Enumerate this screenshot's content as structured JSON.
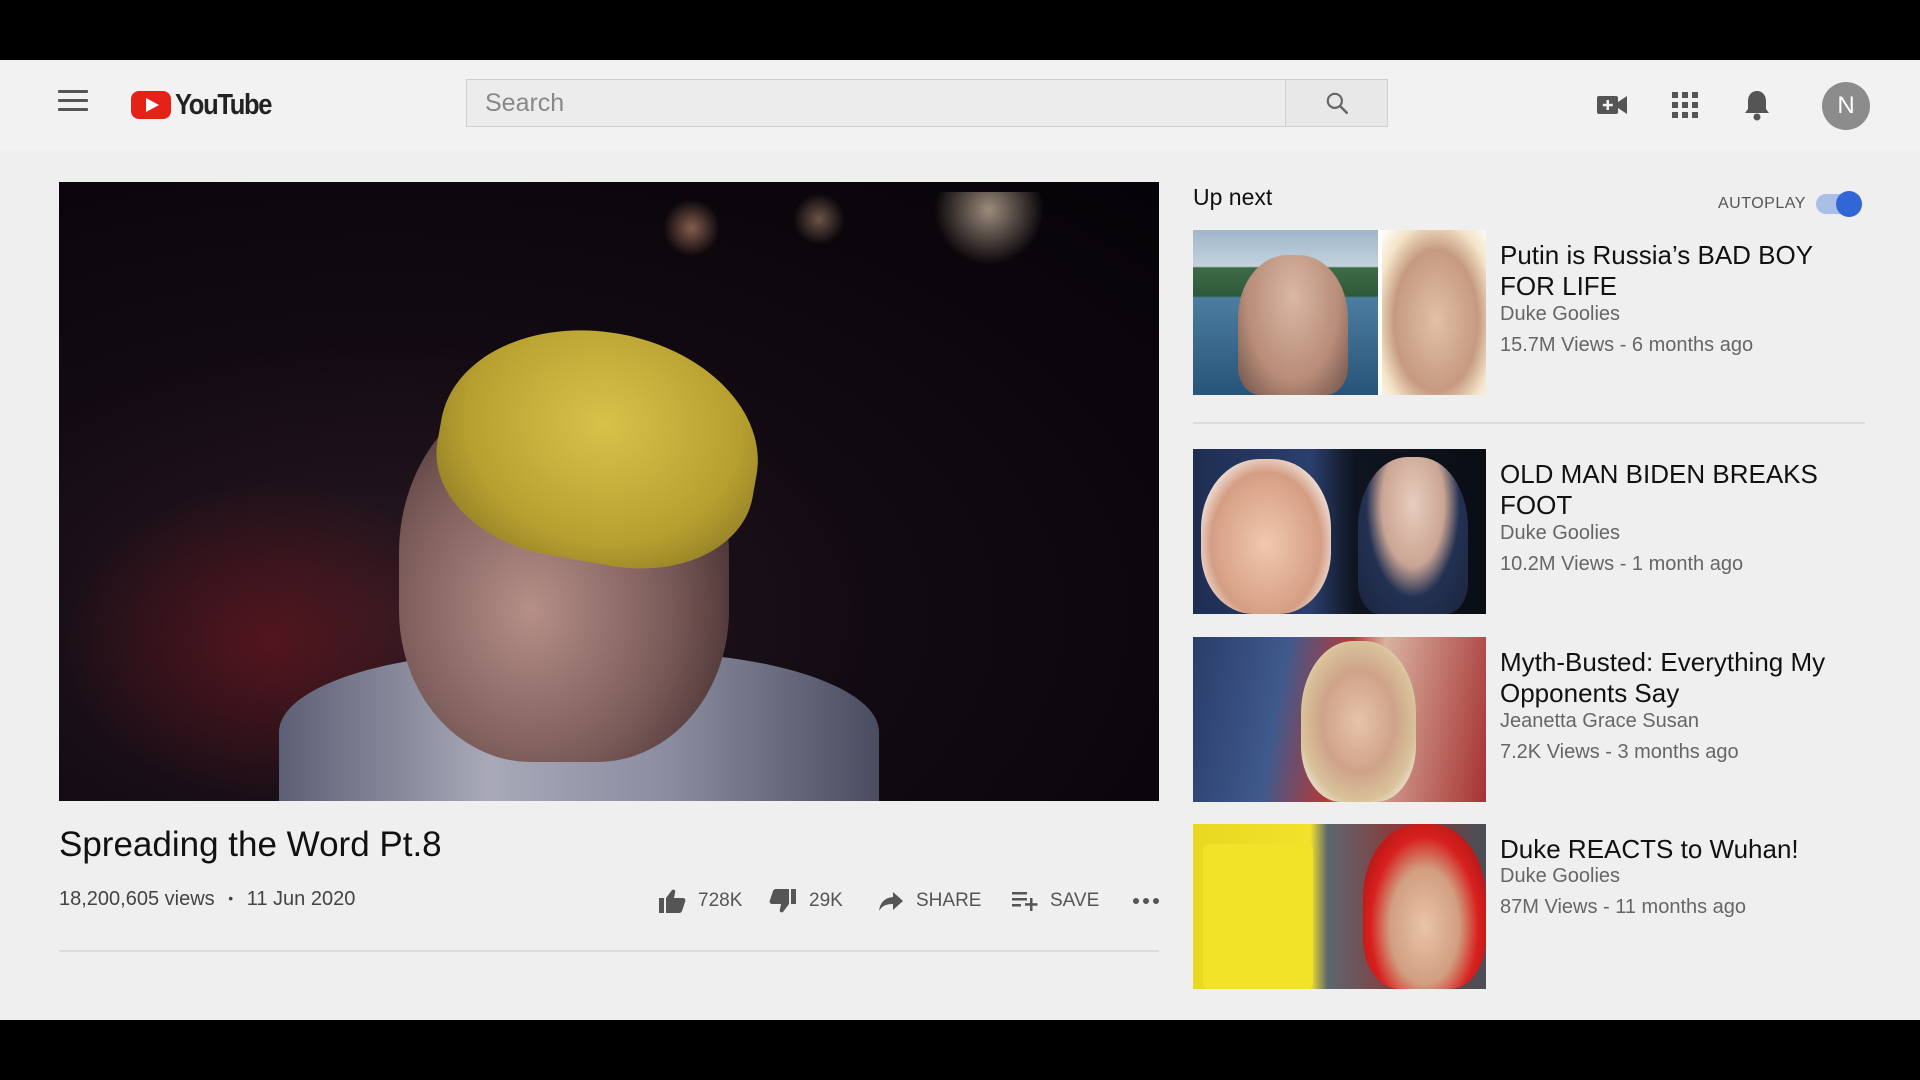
{
  "header": {
    "logo_text": "YouTube",
    "search_placeholder": "Search",
    "avatar_letter": "N"
  },
  "video": {
    "title": "Spreading the Word Pt.8",
    "views": "18,200,605 views",
    "date": "11 Jun 2020",
    "separator": "•",
    "likes": "728K",
    "dislikes": "29K",
    "share_label": "SHARE",
    "save_label": "SAVE"
  },
  "sidebar": {
    "up_next_label": "Up next",
    "autoplay_label": "AUTOPLAY",
    "autoplay_on": true,
    "items": [
      {
        "title": "Putin is Russia’s BAD BOY FOR LIFE",
        "channel": "Duke Goolies",
        "stats": "15.7M Views - 6 months ago"
      },
      {
        "title": "OLD MAN BIDEN BREAKS FOOT",
        "channel": "Duke Goolies",
        "stats": "10.2M Views - 1 month ago"
      },
      {
        "title": "Myth-Busted: Everything My Opponents Say",
        "channel": "Jeanetta Grace Susan",
        "stats": "7.2K Views - 3 months ago"
      },
      {
        "title": "Duke REACTS to Wuhan!",
        "channel": "Duke Goolies",
        "stats": "87M Views - 11 months ago"
      }
    ]
  },
  "icons": {
    "menu": "hamburger-icon",
    "search": "search-icon",
    "create": "video-camera-plus-icon",
    "apps": "apps-grid-icon",
    "notifications": "bell-icon",
    "like": "thumbs-up-icon",
    "dislike": "thumbs-down-icon",
    "share": "share-arrow-icon",
    "save": "playlist-add-icon",
    "more": "more-horizontal-icon"
  },
  "colors": {
    "brand_red": "#e62117",
    "toggle_blue": "#3166d6",
    "background": "#efeff0"
  }
}
